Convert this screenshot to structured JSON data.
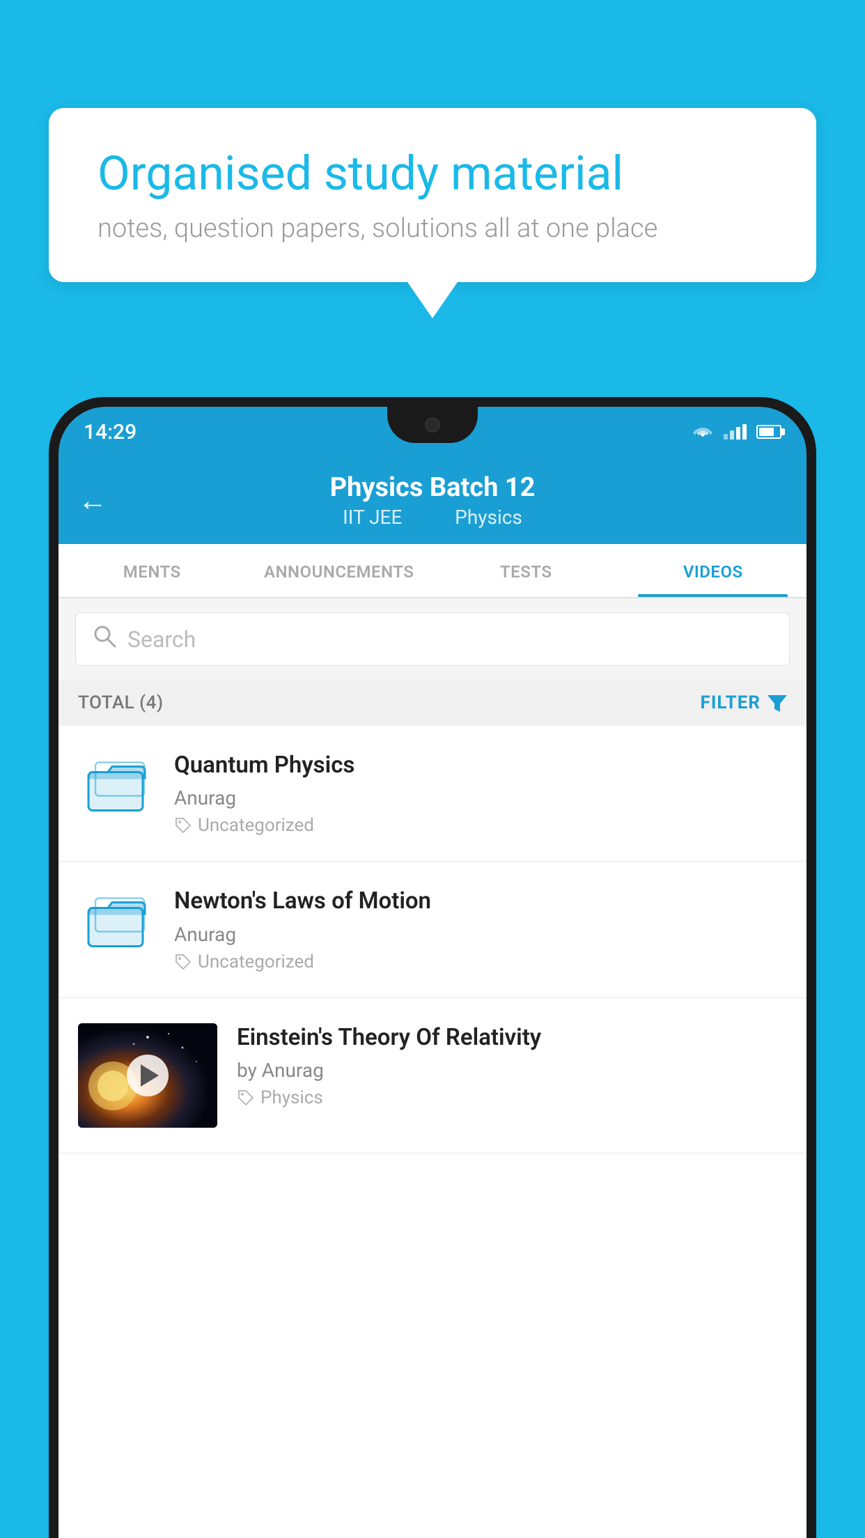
{
  "background_color": "#1ab9e8",
  "speech_bubble": {
    "title": "Organised study material",
    "subtitle": "notes, question papers, solutions all at one place"
  },
  "phone": {
    "status_bar": {
      "time": "14:29",
      "wifi": "wifi",
      "signal": "signal",
      "battery": "battery"
    },
    "header": {
      "back_label": "←",
      "title": "Physics Batch 12",
      "subtitle_part1": "IIT JEE",
      "subtitle_part2": "Physics"
    },
    "tabs": [
      {
        "label": "MENTS",
        "active": false
      },
      {
        "label": "ANNOUNCEMENTS",
        "active": false
      },
      {
        "label": "TESTS",
        "active": false
      },
      {
        "label": "VIDEOS",
        "active": true
      }
    ],
    "search": {
      "placeholder": "Search"
    },
    "filter_bar": {
      "total_label": "TOTAL (4)",
      "filter_label": "FILTER"
    },
    "videos": [
      {
        "id": 1,
        "title": "Quantum Physics",
        "author": "Anurag",
        "tag": "Uncategorized",
        "has_thumb": false
      },
      {
        "id": 2,
        "title": "Newton's Laws of Motion",
        "author": "Anurag",
        "tag": "Uncategorized",
        "has_thumb": false
      },
      {
        "id": 3,
        "title": "Einstein's Theory Of Relativity",
        "author": "by Anurag",
        "tag": "Physics",
        "has_thumb": true
      }
    ]
  }
}
